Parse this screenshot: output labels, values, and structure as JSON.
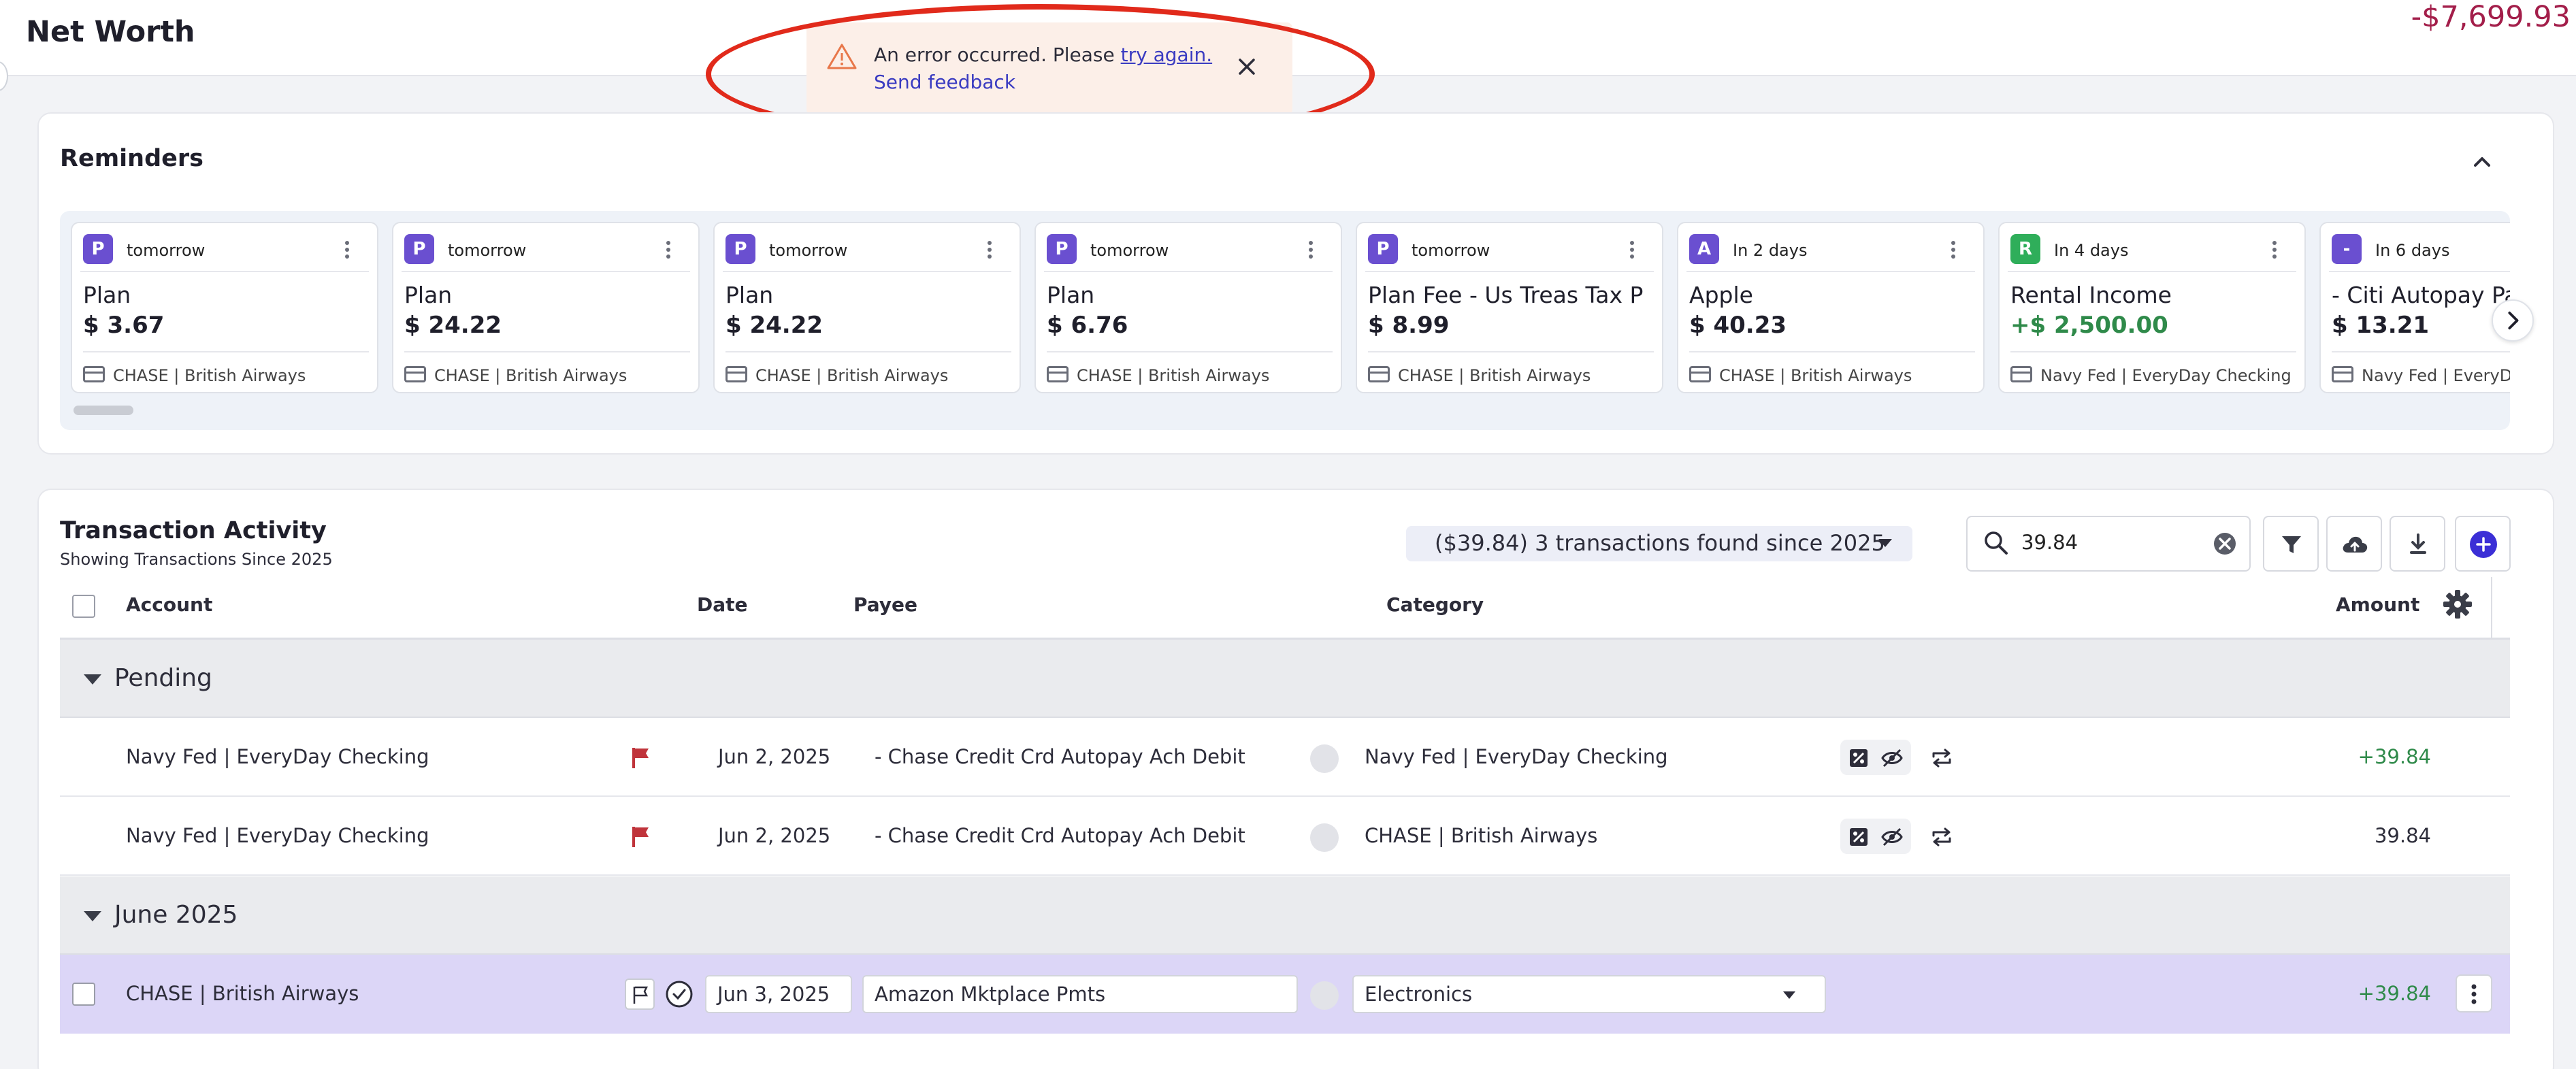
{
  "header": {
    "title": "Net Worth",
    "net_worth": "-$7,699.93"
  },
  "toast": {
    "message": "An error occurred. Please",
    "link_try": "try again.",
    "link_feedback": "Send feedback"
  },
  "reminders": {
    "title": "Reminders",
    "cards": [
      {
        "badge": "P",
        "when": "tomorrow",
        "name": "Plan",
        "amount": "$ 3.67",
        "account": "CHASE | British Airways",
        "positive": false
      },
      {
        "badge": "P",
        "when": "tomorrow",
        "name": "Plan",
        "amount": "$ 24.22",
        "account": "CHASE | British Airways",
        "positive": false
      },
      {
        "badge": "P",
        "when": "tomorrow",
        "name": "Plan",
        "amount": "$ 24.22",
        "account": "CHASE | British Airways",
        "positive": false
      },
      {
        "badge": "P",
        "when": "tomorrow",
        "name": "Plan",
        "amount": "$ 6.76",
        "account": "CHASE | British Airways",
        "positive": false
      },
      {
        "badge": "P",
        "when": "tomorrow",
        "name": "Plan Fee - Us Treas Tax P",
        "amount": "$ 8.99",
        "account": "CHASE | British Airways",
        "positive": false
      },
      {
        "badge": "A",
        "when": "In 2 days",
        "name": "Apple",
        "amount": "$ 40.23",
        "account": "CHASE | British Airways",
        "positive": false
      },
      {
        "badge": "R",
        "when": "In 4 days",
        "name": "Rental Income",
        "amount": "+$ 2,500.00",
        "account": "Navy Fed | EveryDay Checking",
        "positive": true
      },
      {
        "badge": "-",
        "when": "In 6 days",
        "name": "- Citi Autopay Pa",
        "amount": "$ 13.21",
        "account": "Navy Fed | EveryD",
        "positive": false
      }
    ]
  },
  "transactions": {
    "title": "Transaction Activity",
    "subtitle": "Showing Transactions Since 2025",
    "found": "($39.84) 3 transactions found since 2025",
    "search_value": "39.84",
    "columns": {
      "account": "Account",
      "date": "Date",
      "payee": "Payee",
      "category": "Category",
      "amount": "Amount"
    },
    "groups": {
      "pending": {
        "label": "Pending",
        "rows": [
          {
            "account": "Navy Fed | EveryDay Checking",
            "date": "Jun 2, 2025",
            "payee": "- Chase Credit Crd Autopay Ach Debit",
            "category": "Navy Fed | EveryDay Checking",
            "amount": "+39.84"
          },
          {
            "account": "Navy Fed | EveryDay Checking",
            "date": "Jun 2, 2025",
            "payee": "- Chase Credit Crd Autopay Ach Debit",
            "category": "CHASE | British Airways",
            "amount": "39.84"
          }
        ]
      },
      "june": {
        "label": "June 2025",
        "rows": [
          {
            "account": "CHASE | British Airways",
            "date": "Jun 3, 2025",
            "payee": "Amazon Mktplace Pmts",
            "category": "Electronics",
            "amount": "+39.84"
          }
        ]
      }
    }
  },
  "colors": {
    "accent": "#6a4fd0",
    "negative": "#a31e4a",
    "positive": "#2f8a4a",
    "annotation": "#e12a1b",
    "selected_row": "#dcd6f7"
  }
}
